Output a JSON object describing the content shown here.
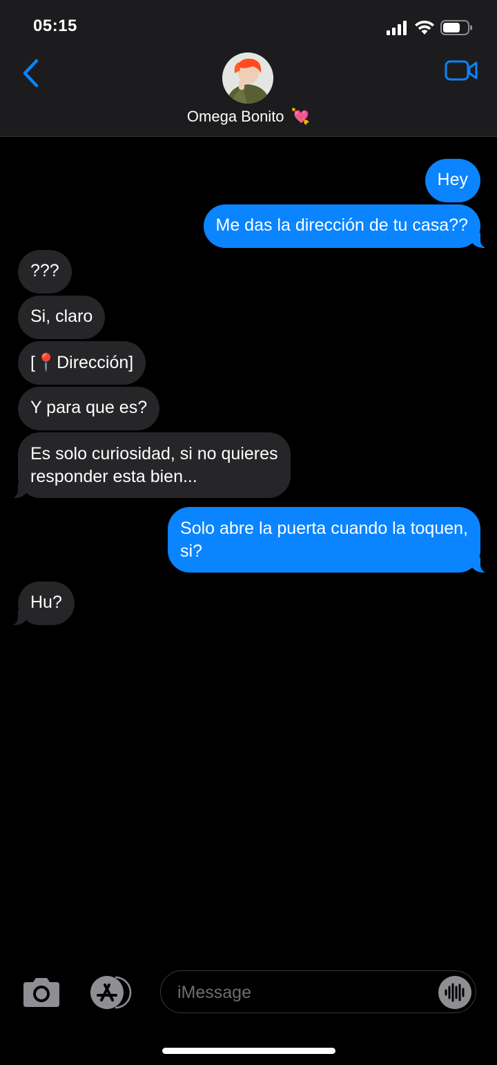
{
  "status_bar": {
    "time": "05:15"
  },
  "header": {
    "contact_name": "Omega Bonito",
    "contact_emoji": "💘"
  },
  "messages": [
    {
      "direction": "outgoing",
      "text": "Hey"
    },
    {
      "direction": "outgoing",
      "text": "Me das la dirección de tu casa??"
    },
    {
      "direction": "incoming",
      "text": "???"
    },
    {
      "direction": "incoming",
      "text": "Si, claro"
    },
    {
      "direction": "incoming",
      "text_before": "[",
      "pin_emoji": "📍",
      "text_after": "Dirección]"
    },
    {
      "direction": "incoming",
      "text": "Y para que es?"
    },
    {
      "direction": "incoming",
      "lines": [
        "Es solo curiosidad, si no quieres",
        "responder esta bien..."
      ]
    },
    {
      "direction": "outgoing",
      "lines": [
        "Solo abre la puerta cuando la toquen,",
        "si?"
      ]
    },
    {
      "direction": "incoming",
      "text": "Hu?"
    }
  ],
  "composer": {
    "placeholder": "iMessage"
  },
  "colors": {
    "outgoing_bubble": "#0a84ff",
    "incoming_bubble": "#262629",
    "accent": "#0a84ff"
  }
}
